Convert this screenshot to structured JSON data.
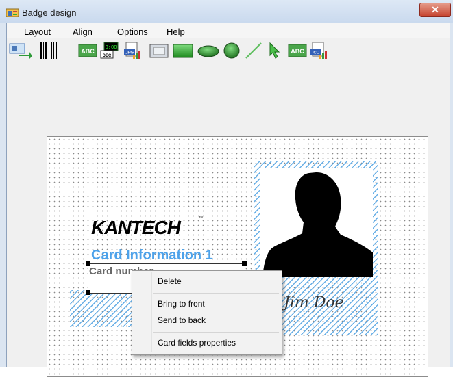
{
  "window": {
    "title": "Badge design",
    "close_label": "✕"
  },
  "menu": [
    {
      "label": "Layout"
    },
    {
      "label": "Align"
    },
    {
      "label": "Options"
    },
    {
      "label": "Help"
    }
  ],
  "toolbar": {
    "tools": [
      {
        "name": "import-export-icon"
      },
      {
        "name": "barcode-icon"
      },
      {
        "name": "text-field-icon",
        "text": "ABC"
      },
      {
        "name": "counter-field-icon",
        "text": "0:00",
        "subtext": "DEC"
      },
      {
        "name": "jpg-image-icon",
        "text": "JPG"
      },
      {
        "name": "frame-icon"
      },
      {
        "name": "rectangle-icon"
      },
      {
        "name": "ellipse-icon"
      },
      {
        "name": "circle-icon"
      },
      {
        "name": "line-icon"
      },
      {
        "name": "select-pointer-icon"
      },
      {
        "name": "text-label-icon",
        "text": "ABC"
      },
      {
        "name": "ico-image-icon",
        "text": "ICO"
      }
    ]
  },
  "badge": {
    "logo_text": "KANTECH",
    "logo_tm": "™",
    "card_info": "Card Information 1",
    "card_number": "Card number",
    "signature_text": "Jim Doe",
    "accent_color": "#4da2ea"
  },
  "context_menu": {
    "items": [
      {
        "label": "Delete"
      },
      {
        "label": "Bring to front"
      },
      {
        "label": "Send to back"
      },
      {
        "label": "Card fields properties"
      }
    ]
  }
}
